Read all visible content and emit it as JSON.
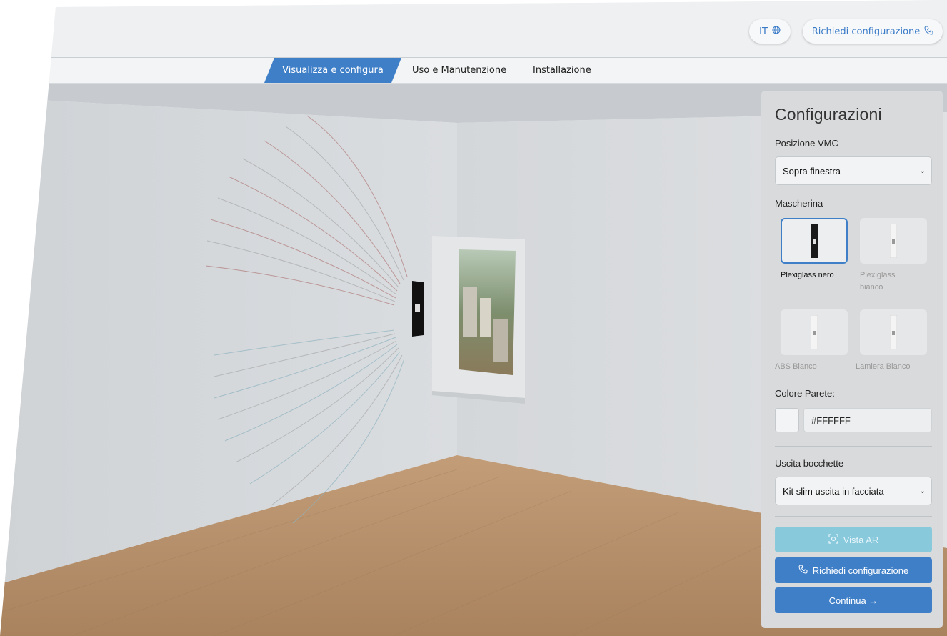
{
  "header": {
    "language_label": "IT",
    "language_icon": "globe-icon",
    "request_label": "Richiedi configurazione",
    "request_icon": "phone-icon"
  },
  "tabs": [
    {
      "label": "Visualizza e configura",
      "active": true
    },
    {
      "label": "Uso e Manutenzione",
      "active": false
    },
    {
      "label": "Installazione",
      "active": false
    }
  ],
  "panel": {
    "title": "Configurazioni",
    "position_label": "Posizione VMC",
    "position_value": "Sopra finestra",
    "mask_label": "Mascherina",
    "mask_options": [
      {
        "label": "Plexiglass nero",
        "selected": true,
        "color": "#1a1a1a"
      },
      {
        "label": "Plexiglass bianco",
        "selected": false,
        "color": "#e8e8e8"
      },
      {
        "label": "ABS Bianco",
        "selected": false,
        "color": "#e8e8e8"
      },
      {
        "label": "Lamiera Bianco",
        "selected": false,
        "color": "#e8e8e8"
      }
    ],
    "wall_color_label": "Colore Parete:",
    "wall_color_value": "#FFFFFF",
    "outlet_label": "Uscita bocchette",
    "outlet_value": "Kit slim uscita in facciata",
    "ar_button": "Vista AR",
    "request_button": "Richiedi configurazione",
    "continue_button": "Continua →"
  },
  "colors": {
    "accent": "#3f7fc8",
    "ar_button": "#88c9dc",
    "floor": "#b58f6b",
    "wall": "#dde0e2"
  }
}
